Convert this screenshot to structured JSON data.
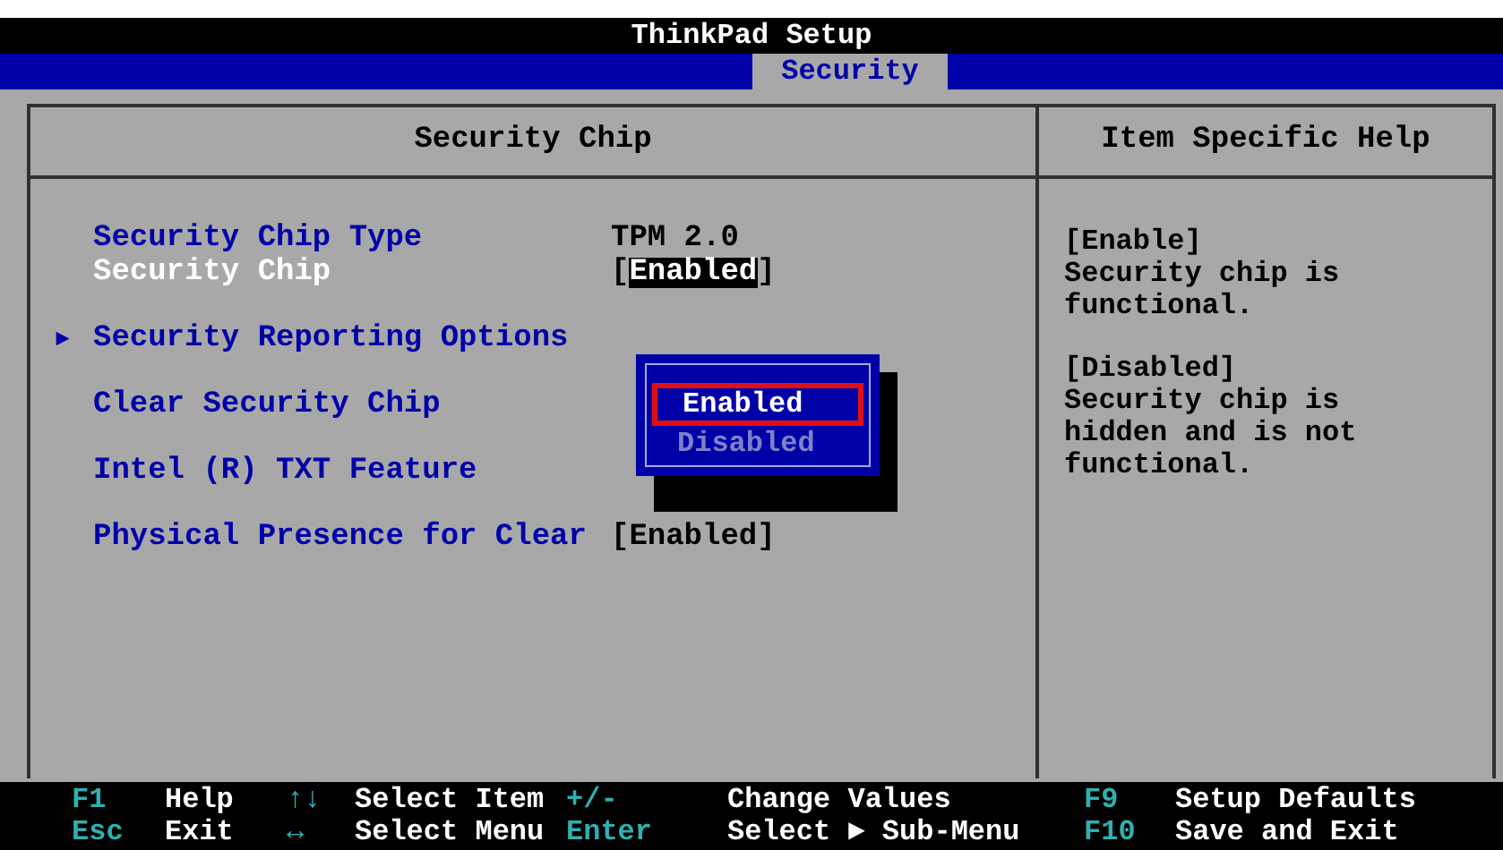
{
  "window": {
    "title": "ThinkPad Setup"
  },
  "tabs": [
    {
      "label": "Security",
      "selected": true
    }
  ],
  "panel": {
    "title": "Security Chip",
    "help_title": "Item Specific Help"
  },
  "items": [
    {
      "kind": "info",
      "label": "Security Chip Type",
      "value": "TPM 2.0",
      "selected": false
    },
    {
      "kind": "option",
      "label": "Security Chip",
      "open": "[",
      "value": "Enabled",
      "close": "]",
      "selected": true
    },
    {
      "kind": "submenu",
      "label": "Security Reporting Options",
      "arrow": "►",
      "selected": false
    },
    {
      "kind": "action",
      "label": "Clear Security Chip",
      "selected": false
    },
    {
      "kind": "action",
      "label": "Intel (R) TXT Feature",
      "selected": false
    },
    {
      "kind": "option",
      "label": "Physical Presence for Clear",
      "open": "[",
      "value": "Enabled",
      "close": "]",
      "selected": false
    }
  ],
  "popup": {
    "options": [
      {
        "label": "Enabled",
        "selected": true
      },
      {
        "label": "Disabled",
        "selected": false
      }
    ]
  },
  "help": [
    {
      "heading": "[Enable]",
      "text": "Security chip is functional."
    },
    {
      "heading": "[Disabled]",
      "text": "Security chip is hidden and is not functional."
    }
  ],
  "footer": [
    [
      {
        "key": "F1",
        "action": "Help"
      },
      {
        "key": "↑↓",
        "action": "Select Item"
      },
      {
        "key": "+/-",
        "action": "Change Values"
      },
      {
        "key": "F9",
        "action": "Setup Defaults"
      }
    ],
    [
      {
        "key": "Esc",
        "action": "Exit"
      },
      {
        "key": "↔",
        "action": "Select Menu"
      },
      {
        "key": "Enter",
        "action": "Select ► Sub-Menu"
      },
      {
        "key": "F10",
        "action": "Save and Exit"
      }
    ]
  ]
}
